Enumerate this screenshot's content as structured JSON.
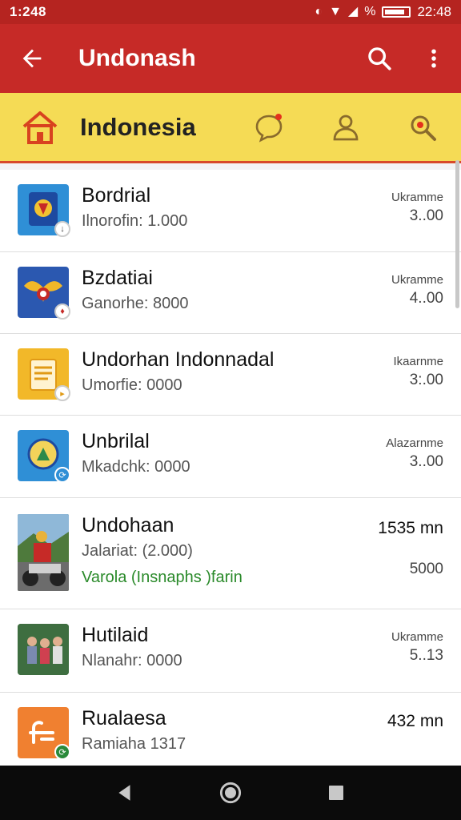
{
  "status_bar": {
    "time_left": "1:248",
    "time_right": "22:48",
    "percent_icon": "%"
  },
  "app_bar": {
    "title": "Undonash"
  },
  "tab_bar": {
    "title": "Indonesia"
  },
  "items": [
    {
      "title": "Bordrial",
      "subtitle": "Ilnorofin: 1.000",
      "right_top": "Ukramme",
      "right_bottom": "3..00",
      "thumb_color": "#2f8fd6"
    },
    {
      "title": "Bzdatiai",
      "subtitle": "Ganorhe: 8000",
      "right_top": "Ukramme",
      "right_bottom": "4..00",
      "thumb_color": "#2b58b0"
    },
    {
      "title": "Undorhan Indonnadal",
      "subtitle": "Umorfie: 0000",
      "right_top": "Ikaarnme",
      "right_bottom": "3:.00",
      "thumb_color": "#f2b829"
    },
    {
      "title": "Unbrilal",
      "subtitle": "Mkadchk: 0000",
      "right_top": "Alazarnme",
      "right_bottom": "3..00",
      "thumb_color": "#2f8fd6"
    },
    {
      "title": "Undohaan",
      "subtitle": "Jalariat: (2.000)",
      "extra": "Varola (Insnaphs )farin",
      "right_top": "1535 mn",
      "right_bottom": "5000",
      "thumb_color": "#6a8a5a"
    },
    {
      "title": "Hutilaid",
      "subtitle": "Nlanahr: 0000",
      "right_top": "Ukramme",
      "right_bottom": "5..13",
      "thumb_color": "#3a6a3a"
    },
    {
      "title": "Rualaesa",
      "subtitle": "Ramiaha 1317",
      "right_top": "432 mn",
      "right_bottom": "",
      "thumb_color": "#f08030"
    }
  ]
}
